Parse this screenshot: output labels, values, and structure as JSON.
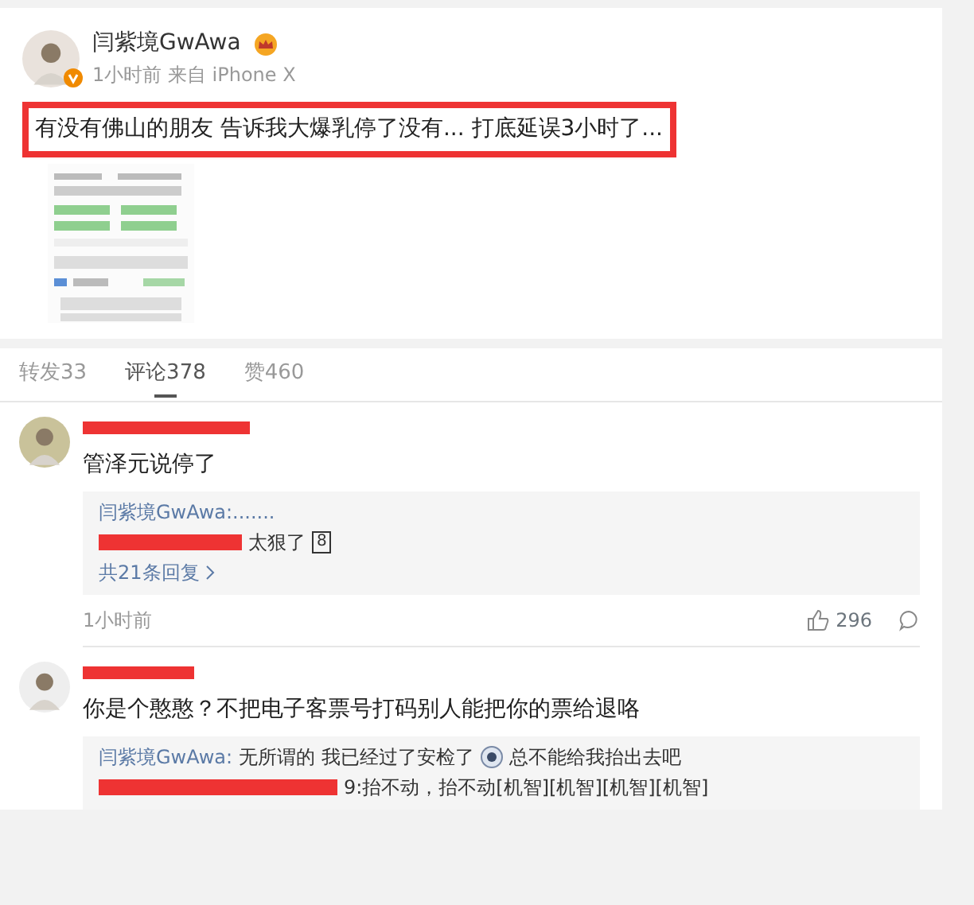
{
  "post": {
    "author": "闫紫境GwAwa",
    "meta": "1小时前 来自 iPhone X",
    "text": "有没有佛山的朋友 告诉我大爆乳停了没有... 打底延误3小时了..."
  },
  "tabs": [
    {
      "label": "转发33",
      "selected": false
    },
    {
      "label": "评论378",
      "selected": true
    },
    {
      "label": "赞460",
      "selected": false
    }
  ],
  "comments": [
    {
      "text": "管泽元说停了",
      "replies": [
        [
          {
            "kind": "author",
            "text": "闫紫境GwAwa:......."
          }
        ],
        [
          {
            "kind": "redacted"
          },
          {
            "kind": "text",
            "text": "太狠了"
          },
          {
            "kind": "boxed",
            "text": "8"
          }
        ]
      ],
      "more": "共21条回复",
      "time": "1小时前",
      "likes": "296"
    },
    {
      "text": "你是个憨憨？不把电子客票号打码别人能把你的票给退咯",
      "replies": [
        [
          {
            "kind": "author",
            "text": "闫紫境GwAwa:"
          },
          {
            "kind": "text",
            "text": "无所谓的 我已经过了安检了"
          },
          {
            "kind": "emoji"
          },
          {
            "kind": "text",
            "text": "总不能给我抬出去吧"
          }
        ],
        [
          {
            "kind": "redacted"
          },
          {
            "kind": "text",
            "text": "9:抬不动，抬不动[机智][机智][机智][机智]"
          }
        ]
      ]
    }
  ]
}
